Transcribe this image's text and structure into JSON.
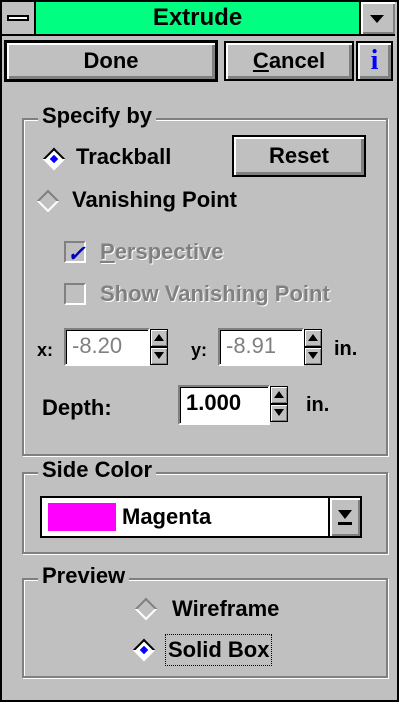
{
  "window": {
    "title": "Extrude"
  },
  "buttons": {
    "done": "Done",
    "cancel_prefix": "C",
    "cancel_rest": "ancel",
    "info": "i",
    "reset": "Reset"
  },
  "specify_by": {
    "legend": "Specify by",
    "trackball_label": "Trackball",
    "trackball_selected": true,
    "vanishing_label": "Vanishing Point",
    "vanishing_selected": false,
    "perspective_prefix": "P",
    "perspective_rest": "erspective",
    "perspective_checked": true,
    "show_vanishing_label": "Show Vanishing Point",
    "show_vanishing_checked": false,
    "x_label": "x:",
    "x_value": "-8.20",
    "y_label": "y:",
    "y_value": "-8.91",
    "xy_unit": "in.",
    "depth_label": "Depth:",
    "depth_value": "1.000",
    "depth_unit": "in."
  },
  "side_color": {
    "legend": "Side Color",
    "selected": "Magenta",
    "swatch_color": "#ff00ff"
  },
  "preview": {
    "legend": "Preview",
    "wireframe_label": "Wireframe",
    "wireframe_selected": false,
    "solidbox_label": "Solid Box",
    "solidbox_selected": true
  },
  "colors": {
    "title_bar": "#00ff80",
    "face": "#c0c0c0",
    "accent": "#0000ff"
  },
  "icons": {
    "system_menu": "system-menu-icon",
    "title_dropdown": "triangle-down-icon",
    "info": "info-icon",
    "combo_arrow": "arrow-down-icon"
  }
}
